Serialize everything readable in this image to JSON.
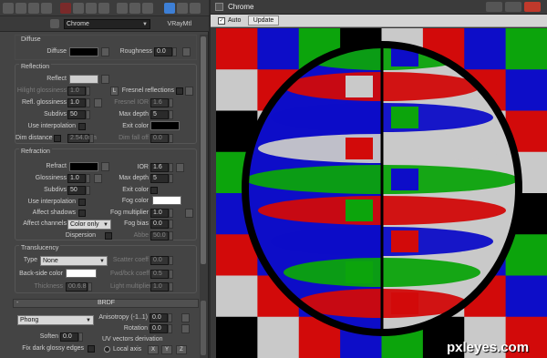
{
  "toolbar": {
    "icons": [
      "eyedropper-icon",
      "teapot-icon",
      "teapot-icon",
      "teapot-icon",
      "delete-icon",
      "copy-icon",
      "duplicate-icon",
      "material-icon",
      "assign-icon",
      "map-icon",
      "texture-icon",
      "show-map-icon",
      "background-icon",
      "sample-icon"
    ],
    "material_name": "Chrome",
    "material_type": "VRayMtl"
  },
  "diffuse": {
    "title": "Diffuse",
    "diffuse_label": "Diffuse",
    "diffuse_color": "#000000",
    "roughness_label": "Roughness",
    "roughness_value": "0.0"
  },
  "reflection": {
    "title": "Reflection",
    "reflect_label": "Reflect",
    "reflect_color": "#cfcfcf",
    "hilight_glossiness_label": "Hilight glossiness",
    "hilight_glossiness_value": "1.0",
    "lock_label": "L",
    "fresnel_label": "Fresnel reflections",
    "refl_glossiness_label": "Refl. glossiness",
    "refl_glossiness_value": "1.0",
    "fresnel_ior_label": "Fresnel IOR",
    "fresnel_ior_value": "1.6",
    "subdivs_label": "Subdivs",
    "subdivs_value": "50",
    "max_depth_label": "Max depth",
    "max_depth_value": "5",
    "use_interpolation_label": "Use interpolation",
    "exit_color_label": "Exit color",
    "exit_color": "#000000",
    "dim_distance_label": "Dim distance",
    "dim_distance_value": "2.54.0cm",
    "dim_falloff_label": "Dim fall off",
    "dim_falloff_value": "0.0"
  },
  "refraction": {
    "title": "Refraction",
    "refract_label": "Refract",
    "refract_color": "#000000",
    "ior_label": "IOR",
    "ior_value": "1.6",
    "glossiness_label": "Glossiness",
    "glossiness_value": "1.0",
    "max_depth_label": "Max depth",
    "max_depth_value": "5",
    "subdivs_label": "Subdivs",
    "subdivs_value": "50",
    "exit_color_label": "Exit color",
    "use_interpolation_label": "Use interpolation",
    "fog_color_label": "Fog color",
    "fog_color": "#ffffff",
    "affect_shadows_label": "Affect shadows",
    "fog_multiplier_label": "Fog multiplier",
    "fog_multiplier_value": "1.0",
    "affect_channels_label": "Affect channels",
    "affect_channels_value": "Color only",
    "fog_bias_label": "Fog bias",
    "fog_bias_value": "0.0",
    "dispersion_label": "Dispersion",
    "abbe_label": "Abbe",
    "abbe_value": "50.0"
  },
  "translucency": {
    "title": "Translucency",
    "type_label": "Type",
    "type_value": "None",
    "scatter_coeff_label": "Scatter coeff",
    "scatter_coeff_value": "0.0",
    "back_side_color_label": "Back-side color",
    "back_side_color": "#ffffff",
    "fwd_bck_coeff_label": "Fwd/bck coeff",
    "fwd_bck_coeff_value": "0.5",
    "thickness_label": "Thickness",
    "thickness_value": "00.6.8",
    "light_multiplier_label": "Light multiplier",
    "light_multiplier_value": "1.0"
  },
  "brdf": {
    "title": "BRDF",
    "collapse_label": "-",
    "type_value": "Phong",
    "anisotropy_label": "Anisotropy (-1..1)",
    "anisotropy_value": "0.0",
    "rotation_label": "Rotation",
    "rotation_value": "0.0",
    "soften_label": "Soften",
    "soften_value": "0.0",
    "uv_derivation_label": "UV vectors derivation",
    "fix_glossy_label": "Fix dark glossy edges",
    "local_axis_label": "Local axis",
    "x_label": "X",
    "y_label": "Y",
    "z_label": "Z"
  },
  "render_window": {
    "title": "Chrome",
    "auto_label": "Auto",
    "update_label": "Update",
    "palette": {
      "red": "#d20a0a",
      "green": "#0ca40c",
      "blue": "#0d0dc8",
      "white": "#c9c9c9",
      "black": "#000000"
    }
  },
  "watermark": "pxleyes.com"
}
